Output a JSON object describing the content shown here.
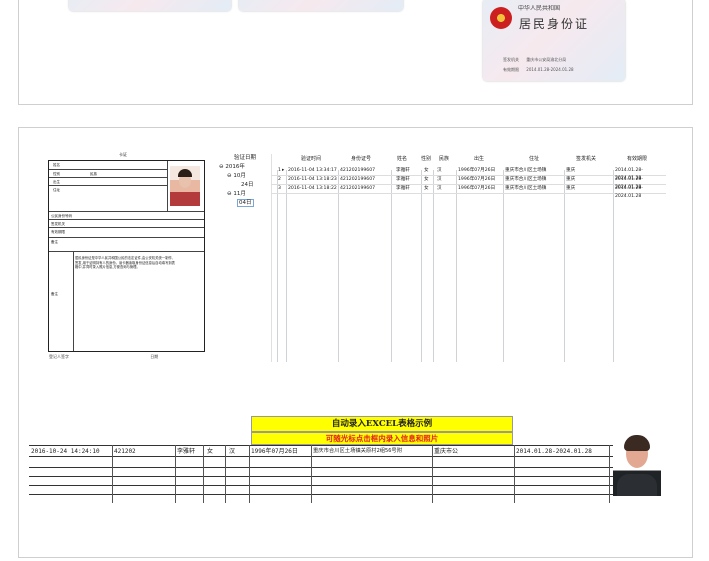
{
  "id_card": {
    "national_emblem": "national-emblem-icon",
    "header_line": "中华人民共和国",
    "title": "居民身份证",
    "authority_label": "签发机关",
    "authority_value": "重庆市公安局渝北分局",
    "validity_label": "有效期限",
    "validity_value": "2014.01.28-2024.01.28"
  },
  "reader": {
    "form": {
      "heading": "卡证",
      "labels": [
        "姓名",
        "性别",
        "民族",
        "出生",
        "住址",
        "公民身份号码",
        "签发机关",
        "有效期限",
        "备注",
        "照片"
      ],
      "notes_text": "居民身份证是中华人民共和国公民的法定证件,由公安机关统一制作、签发,用于证明持有人的身份。读卡器读取身份证信息后自动填写到表格中,并同时录入照片信息,方便查询与管理。",
      "footer_left": "登记人签字",
      "footer_right": "日期"
    },
    "tree": {
      "header": "验证日期",
      "year": "2016年",
      "months": [
        {
          "label": "10月",
          "days": [
            "24日"
          ]
        },
        {
          "label": "11月",
          "days": [
            "04日"
          ]
        }
      ]
    },
    "columns": [
      "验证时间",
      "身份证号",
      "姓名",
      "性别",
      "民族",
      "出生",
      "住址",
      "签发机关",
      "有效期限"
    ],
    "rows": [
      {
        "num": "1",
        "time": "2016-11-04 13:34:17",
        "id": "421202199607",
        "name": "李雅轩",
        "gender": "女",
        "ethnic": "汉",
        "birth": "1996年07月26日",
        "addr": "重庆市合川区土场镇",
        "auth": "重庆",
        "valid": "2014.01.28-2024.01.28"
      },
      {
        "num": "2",
        "time": "2016-11-04 13:18:23",
        "id": "421202199607",
        "name": "李雅轩",
        "gender": "女",
        "ethnic": "汉",
        "birth": "1996年07月26日",
        "addr": "重庆市合川区土场镇",
        "auth": "重庆",
        "valid": "2014.01.28-2024.01.28"
      },
      {
        "num": "3",
        "time": "2016-11-04 13:18:22",
        "id": "421202199607",
        "name": "李雅轩",
        "gender": "女",
        "ethnic": "汉",
        "birth": "1996年07月26日",
        "addr": "重庆市合川区土场镇",
        "auth": "重庆",
        "valid": "2014.01.28-2024.01.28"
      }
    ]
  },
  "excel": {
    "title": "自动录入EXCEL表格示例",
    "subtitle": "可随光标点击框内录入信息和照片",
    "row": {
      "time": "2016-10-24 14:24:10",
      "id": "421202",
      "name": "李雅轩",
      "gender": "女",
      "ethnic": "汉",
      "birth": "1996年07月26日",
      "addr": "重庆市合川区土场镇关原村2组56号附",
      "auth": "重庆市公",
      "valid": "2014.01.28-2024.01.28"
    },
    "colors": {
      "yellow": "#ffff00",
      "title_red": "#222222",
      "subtitle_red": "#e02020"
    }
  }
}
